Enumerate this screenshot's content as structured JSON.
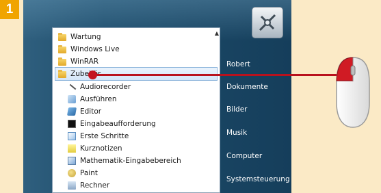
{
  "step": {
    "number": "1"
  },
  "programs": {
    "folders": [
      {
        "label": "Wartung"
      },
      {
        "label": "Windows Live"
      },
      {
        "label": "WinRAR"
      },
      {
        "label": "Zubehör"
      }
    ],
    "accessories": [
      {
        "label": "Audiorecorder",
        "icon": "microphone-icon"
      },
      {
        "label": "Ausführen",
        "icon": "run-icon"
      },
      {
        "label": "Editor",
        "icon": "notepad-icon"
      },
      {
        "label": "Eingabeaufforderung",
        "icon": "command-prompt-icon"
      },
      {
        "label": "Erste Schritte",
        "icon": "getting-started-icon"
      },
      {
        "label": "Kurznotizen",
        "icon": "sticky-notes-icon"
      },
      {
        "label": "Mathematik-Eingabebereich",
        "icon": "math-input-icon"
      },
      {
        "label": "Paint",
        "icon": "paint-icon"
      },
      {
        "label": "Rechner",
        "icon": "calculator-icon"
      }
    ]
  },
  "right_pane": {
    "links": [
      {
        "label": "Robert"
      },
      {
        "label": "Dokumente"
      },
      {
        "label": "Bilder"
      },
      {
        "label": "Musik"
      },
      {
        "label": "Computer"
      },
      {
        "label": "Systemsteuerung"
      }
    ]
  },
  "colors": {
    "badge": "#f0a400",
    "pointer": "#c4131f",
    "background": "#fbeac6",
    "menu": "#1e4d6c"
  }
}
